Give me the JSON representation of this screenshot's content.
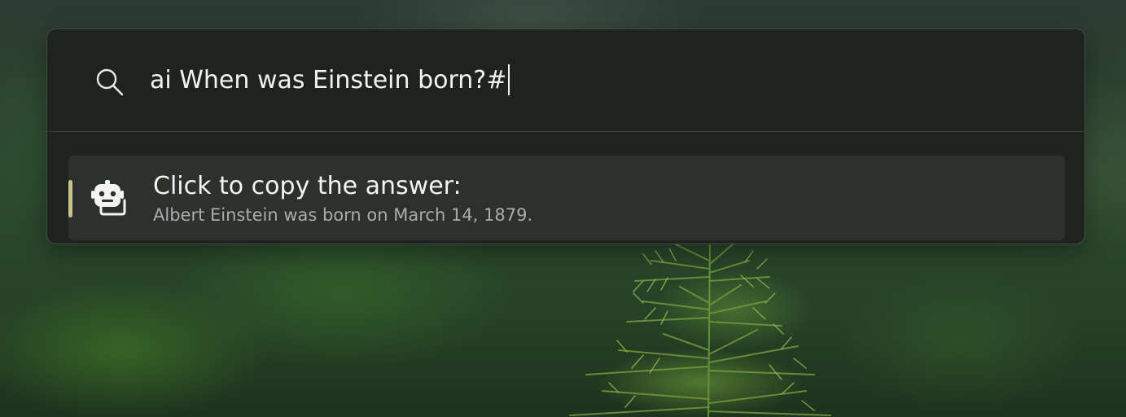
{
  "search": {
    "icon": "search-icon",
    "query": "ai When was Einstein born?#"
  },
  "results": [
    {
      "icon": "ai-copy-icon",
      "title": "Click to copy the answer:",
      "subtitle": "Albert Einstein was born on March 14, 1879."
    }
  ],
  "colors": {
    "panel": "#1f2320",
    "result_highlight": "#2c312e",
    "accent": "#c9c58a",
    "text": "#f2f2f0",
    "subtext": "#a9aca9"
  }
}
